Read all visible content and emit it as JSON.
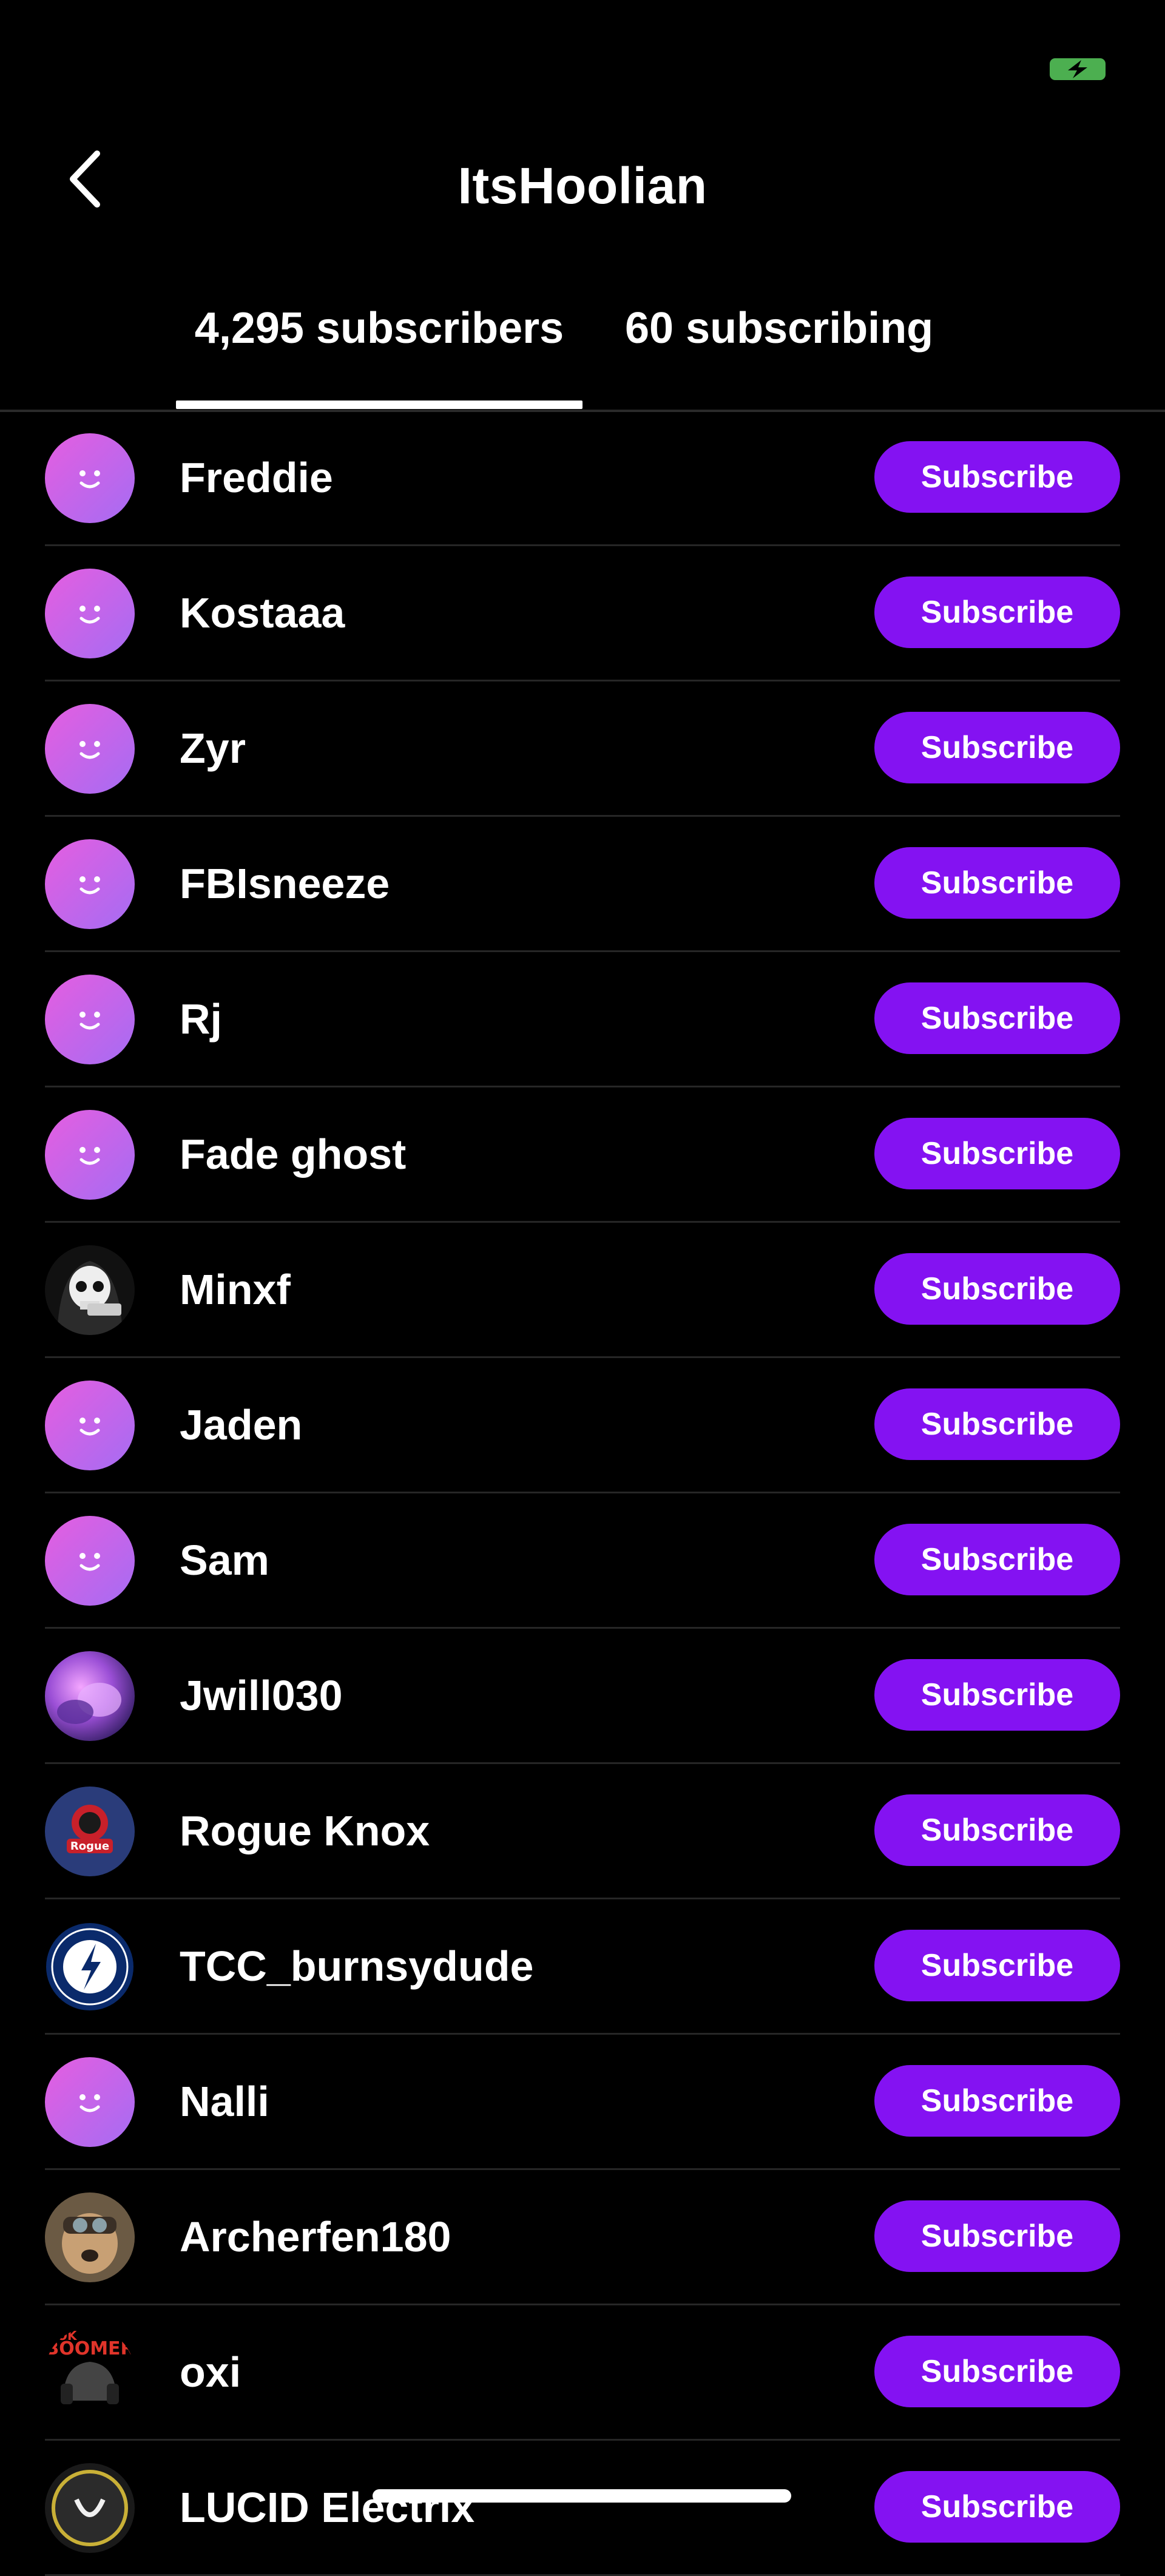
{
  "header": {
    "title": "ItsHoolian"
  },
  "tabs": [
    {
      "label": "4,295 subscribers",
      "active": true
    },
    {
      "label": "60 subscribing",
      "active": false
    }
  ],
  "colors": {
    "accent": "#8412f2",
    "battery": "#4caf50",
    "background": "#000000"
  },
  "subscribe_label": "Subscribe",
  "users": [
    {
      "name": "Freddie",
      "avatar": "default-avatar-icon"
    },
    {
      "name": "Kostaaa",
      "avatar": "default-avatar-icon"
    },
    {
      "name": "Zyr",
      "avatar": "default-avatar-icon"
    },
    {
      "name": "FBIsneeze",
      "avatar": "default-avatar-icon"
    },
    {
      "name": "Rj",
      "avatar": "default-avatar-icon"
    },
    {
      "name": "Fade ghost",
      "avatar": "default-avatar-icon"
    },
    {
      "name": "Minxf",
      "avatar": "skull-avatar"
    },
    {
      "name": "Jaden",
      "avatar": "default-avatar-icon"
    },
    {
      "name": "Sam",
      "avatar": "default-avatar-icon"
    },
    {
      "name": "Jwill030",
      "avatar": "purple-photo-avatar"
    },
    {
      "name": "Rogue Knox",
      "avatar": "rogue-logo-avatar"
    },
    {
      "name": "TCC_burnsydude",
      "avatar": "tampa-bay-lightning-avatar"
    },
    {
      "name": "Nalli",
      "avatar": "default-avatar-icon"
    },
    {
      "name": "Archerfen180",
      "avatar": "dog-photo-avatar"
    },
    {
      "name": "oxi",
      "avatar": "ok-boomer-avatar"
    },
    {
      "name": "LUCID Electrix",
      "avatar": "lucid-logo-avatar"
    }
  ]
}
